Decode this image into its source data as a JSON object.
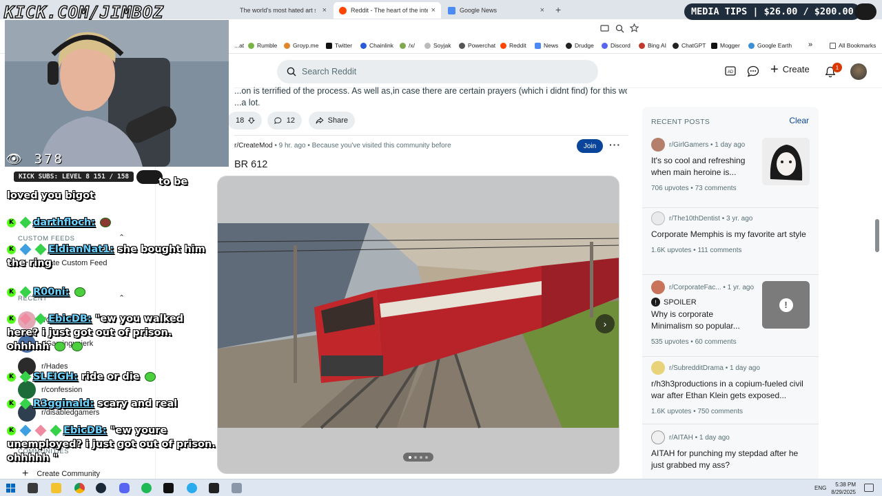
{
  "overlay": {
    "watermark": "KICK.COM/JIMBOZ",
    "viewer_count": "378",
    "media_tips": "MEDIA TIPS | $26.00 / $200.00",
    "kick_subs": "KICK SUBS: LEVEL 8 151 / 158",
    "chat": [
      {
        "user": "",
        "text": "to be loved you bigot"
      },
      {
        "user": "darthfloch:",
        "text": ""
      },
      {
        "user": "EldianNat1:",
        "text": "she bought him the ring"
      },
      {
        "user": "R00ni:",
        "text": ""
      },
      {
        "user": "EbicDB:",
        "text": "\"ew you walked here? i just got out of prison. ohhhhh"
      },
      {
        "user": "SLEIGH:",
        "text": "ride or die"
      },
      {
        "user": "R3gginald:",
        "text": "scary and real"
      },
      {
        "user": "EbicDB:",
        "text": "\"ew youre unemployed? i just got out of prison. ohhhhh \""
      }
    ]
  },
  "browser": {
    "tabs": [
      {
        "label": "The world's most hated art style",
        "active": false
      },
      {
        "label": "Reddit - The heart of the internet",
        "active": true
      },
      {
        "label": "Google News",
        "active": false
      }
    ],
    "new_tab": "+",
    "bookmarks": [
      "...at",
      "Rumble",
      "Groyp.me",
      "Twitter",
      "Chainlink",
      "/x/",
      "Soyjak",
      "Powerchat",
      "Reddit",
      "News",
      "Drudge",
      "Discord",
      "Bing AI",
      "ChatGPT",
      "Mogger",
      "Google Earth"
    ],
    "bookmarks_overflow": "»",
    "all_bookmarks": "All Bookmarks"
  },
  "reddit": {
    "search_placeholder": "Search Reddit",
    "create_label": "Create",
    "notification_count": "1",
    "snippet_line1": "...on is terrified of the process. As well as,in case there are certain prayers (which i didnt find) for this would",
    "snippet_line2": "...a lot.",
    "vote_count": "18",
    "comment_count": "12",
    "share_label": "Share",
    "post": {
      "subreddit": "r/CreateMod",
      "time": "9 hr. ago",
      "reason": "Because you've visited this community before",
      "join_label": "Join",
      "title": "BR 612",
      "carousel_pages": 4,
      "carousel_active": 1
    }
  },
  "leftnav": {
    "custom_feeds_head": "CUSTOM FEEDS",
    "create_custom_feed": "Create Custom Feed",
    "recent_head": "RECENT",
    "items": [
      "r/GirlGamers",
      "r/Gamingunjerk",
      "r/Hades",
      "r/confession",
      "r/disabledgamers"
    ],
    "communities_head": "COMMUNITIES",
    "create_community": "Create Community"
  },
  "recent_posts": {
    "heading": "RECENT POSTS",
    "clear_label": "Clear",
    "posts": [
      {
        "sub": "r/GirlGamers",
        "age": "1 day ago",
        "title": "It's so cool and refreshing when main heroine is...",
        "upvotes": "706 upvotes",
        "comments": "73 comments"
      },
      {
        "sub": "r/The10thDentist",
        "age": "3 yr. ago",
        "title": "Corporate Memphis is my favorite art style",
        "upvotes": "1.6K upvotes",
        "comments": "111 comments"
      },
      {
        "sub": "r/CorporateFac...",
        "age": "1 yr. ago",
        "spoiler": "SPOILER",
        "title": "Why is corporate Minimalism so popular...",
        "upvotes": "535 upvotes",
        "comments": "60 comments"
      },
      {
        "sub": "r/SubredditDrama",
        "age": "1 day ago",
        "title": "r/h3h3productions in a copium-fueled civil war after Ethan Klein gets exposed...",
        "upvotes": "1.6K upvotes",
        "comments": "750 comments"
      },
      {
        "sub": "r/AITAH",
        "age": "1 day ago",
        "title": "AITAH for punching my stepdad after he just grabbed my ass?"
      }
    ]
  },
  "taskbar": {
    "lang": "ENG",
    "time": "5:38 PM",
    "date": "8/29/2025"
  },
  "colors": {
    "join": "#0a449b",
    "badge": "#d93900",
    "kick_green": "#53fc18",
    "chat_user": "#6bd3ff"
  }
}
